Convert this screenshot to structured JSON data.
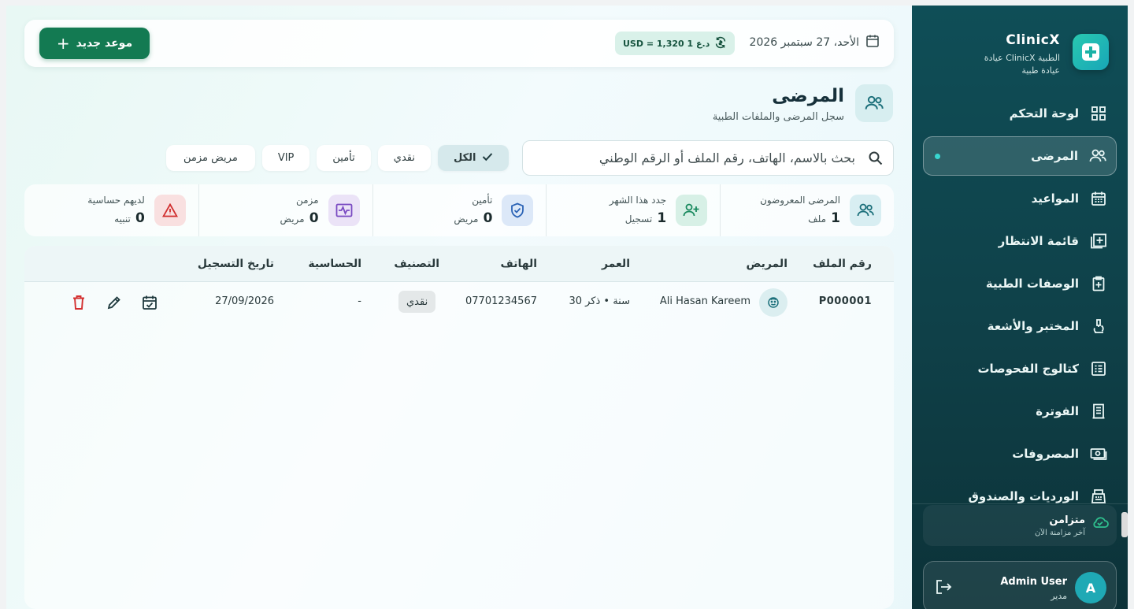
{
  "sidebar": {
    "brand_name": "ClinicX",
    "brand_sub1": "عيادة ClinicX الطبية",
    "brand_sub2": "عيادة طبية",
    "items": [
      {
        "label": "لوحة التحكم",
        "icon": "dashboard-icon"
      },
      {
        "label": "المرضى",
        "icon": "patients-icon",
        "active": true
      },
      {
        "label": "المواعيد",
        "icon": "calendar-icon"
      },
      {
        "label": "قائمة الانتظار",
        "icon": "queue-icon"
      },
      {
        "label": "الوصفات الطبية",
        "icon": "prescription-icon"
      },
      {
        "label": "المختبر والأشعة",
        "icon": "microscope-icon"
      },
      {
        "label": "كتالوج الفحوصات",
        "icon": "catalog-icon"
      },
      {
        "label": "الفوترة",
        "icon": "billing-icon"
      },
      {
        "label": "المصروفات",
        "icon": "expenses-icon"
      },
      {
        "label": "الورديات والصندوق",
        "icon": "cashbox-icon"
      }
    ],
    "sync": {
      "title": "متزامن",
      "subtitle": "آخر مزامنة الآن"
    },
    "user": {
      "avatar_letter": "A",
      "name": "Admin User",
      "role": "مدير"
    }
  },
  "topbar": {
    "new_appointment_label": "موعد جديد",
    "date": "الأحد، 27 سبتمبر 2026",
    "rate": "USD = 1,320 1 د.ع"
  },
  "page": {
    "title": "المرضى",
    "subtitle": "سجل المرضى والملفات الطبية"
  },
  "search": {
    "placeholder": "بحث بالاسم، الهاتف، رقم الملف أو الرقم الوطني"
  },
  "filters": [
    {
      "label": "الكل",
      "active": true
    },
    {
      "label": "نقدي"
    },
    {
      "label": "تأمين"
    },
    {
      "label": "VIP"
    },
    {
      "label": "مريض مزمن"
    }
  ],
  "stats": [
    {
      "label": "المرضى المعروضون",
      "value": "1",
      "unit": "ملف",
      "color": "#d8eef2",
      "icon": "patients-icon"
    },
    {
      "label": "جدد هذا الشهر",
      "value": "1",
      "unit": "تسجيل",
      "color": "#d7f0e6",
      "icon": "add-user-icon"
    },
    {
      "label": "تأمين",
      "value": "0",
      "unit": "مريض",
      "color": "#dce8f8",
      "icon": "shield-icon"
    },
    {
      "label": "مزمن",
      "value": "0",
      "unit": "مريض",
      "color": "#ebe3f7",
      "icon": "pulse-icon"
    },
    {
      "label": "لديهم حساسية",
      "value": "0",
      "unit": "تنبيه",
      "color": "#f9e0e0",
      "icon": "alert-icon"
    }
  ],
  "table": {
    "headers": [
      "رقم الملف",
      "المريض",
      "العمر",
      "الهاتف",
      "التصنيف",
      "الحساسية",
      "تاريخ التسجيل"
    ],
    "rows": [
      {
        "file_no": "P000001",
        "patient": "Ali Hasan Kareem",
        "age": "30 سنة • ذكر",
        "phone": "07701234567",
        "classification": "نقدي",
        "allergy": "-",
        "registered": "27/09/2026"
      }
    ]
  },
  "colors": {
    "sidebar": "#0f4e57",
    "primary_button": "#137a52",
    "accent": "#1fa9b5",
    "delete": "#d32f2f"
  }
}
